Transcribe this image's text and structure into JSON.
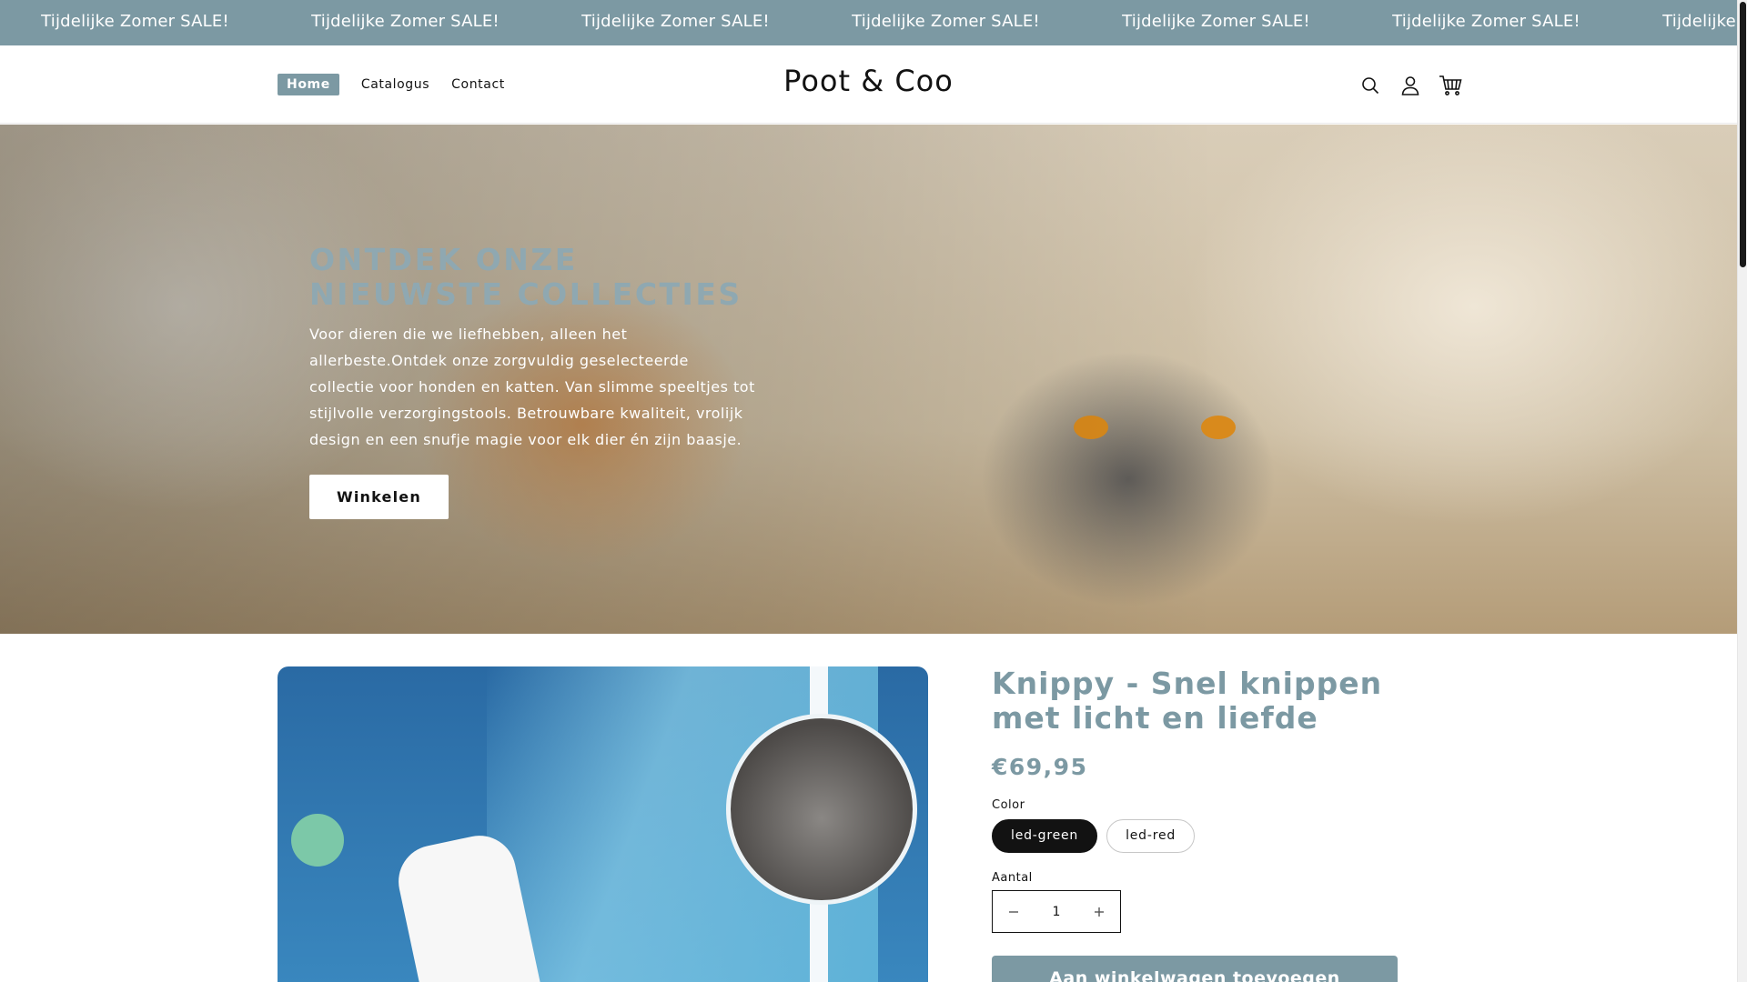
{
  "announcement": {
    "items": [
      "Tijdelijke Zomer SALE!",
      "Tijdelijke Zomer SALE!",
      "Tijdelijke Zomer SALE!",
      "Tijdelijke Zomer SALE!",
      "Tijdelijke Zomer SALE!",
      "Tijdelijke Zomer SALE!",
      "Tijdelijke Zomer SALE!"
    ],
    "background": "#7c99a3"
  },
  "header": {
    "nav": [
      {
        "label": "Home",
        "active": true
      },
      {
        "label": "Catalogus",
        "active": false
      },
      {
        "label": "Contact",
        "active": false
      }
    ],
    "logo": "Poot & Coo",
    "icons": [
      "search-icon",
      "account-icon",
      "cart-icon"
    ]
  },
  "hero": {
    "title": "ONTDEK ONZE NIEUWSTE COLLECTIES",
    "subtitle": "Voor dieren die we liefhebben, alleen het allerbeste.Ontdek onze zorgvuldig geselecteerde collectie voor honden en katten. Van slimme speeltjes tot stijlvolle verzorgingstools. Betrouwbare kwaliteit, vrolijk design en een snufje magie voor elk dier én zijn baasje.",
    "button": "Winkelen"
  },
  "product": {
    "title": "Knippy - Snel knippen met licht en liefde",
    "price": "€69,95",
    "color_label": "Color",
    "colors": [
      {
        "label": "led-green",
        "selected": true
      },
      {
        "label": "led-red",
        "selected": false
      }
    ],
    "quantity_label": "Aantal",
    "quantity": "1",
    "add_to_cart": "Aan winkelwagen toevoegen"
  },
  "colors": {
    "accent": "#7c99a3",
    "dark": "#121212"
  }
}
